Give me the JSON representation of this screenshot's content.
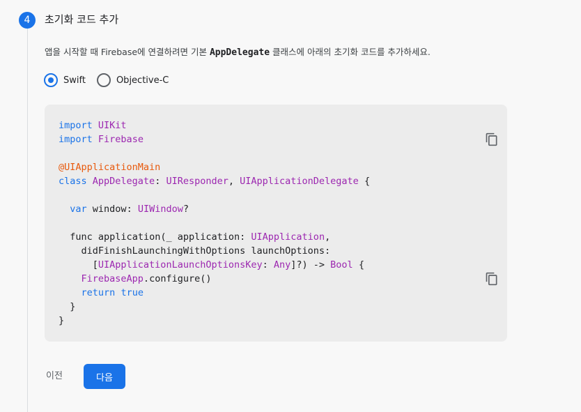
{
  "step": {
    "number": "4",
    "title": "초기화 코드 추가",
    "desc_prefix": "앱을 시작할 때 Firebase에 연결하려면 기본 ",
    "desc_code": "AppDelegate",
    "desc_suffix": " 클래스에 아래의 초기화 코드를 추가하세요."
  },
  "language_options": [
    {
      "label": "Swift",
      "selected": true
    },
    {
      "label": "Objective-C",
      "selected": false
    }
  ],
  "code": {
    "line1_kw": "import",
    "line1_name": "UIKit",
    "line2_kw": "import",
    "line2_name": "Firebase",
    "attr": "@UIApplicationMain",
    "class_kw": "class",
    "class_name": "AppDelegate",
    "superclass": "UIResponder",
    "protocol": "UIApplicationDelegate",
    "var_kw": "var",
    "var_name": "window",
    "var_type": "UIWindow",
    "func_kw": "func",
    "func_name": "application",
    "param_label": "_ application",
    "param_type": "UIApplication",
    "param2": "didFinishLaunchingWithOptions launchOptions",
    "dict_key": "UIApplicationLaunchOptionsKey",
    "dict_val": "Any",
    "return_type": "Bool",
    "call_type": "FirebaseApp",
    "call_method": "configure",
    "return_kw": "return",
    "return_val": "true"
  },
  "icons": {
    "copy_top": "copy-icon",
    "copy_bottom": "copy-icon"
  },
  "buttons": {
    "prev": "이전",
    "next": "다음"
  },
  "colors": {
    "accent": "#1a73e8",
    "keyword": "#1a73e8",
    "type": "#9c27b0",
    "attribute": "#e8590c"
  }
}
